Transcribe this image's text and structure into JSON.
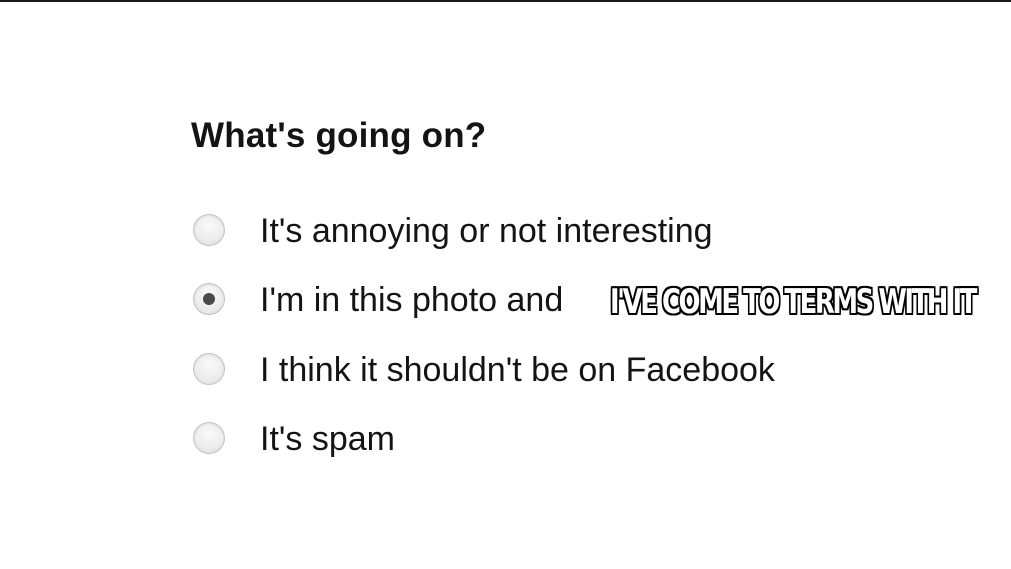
{
  "dialog": {
    "title": "What's going on?",
    "options": [
      {
        "label": "It's annoying or not interesting",
        "selected": false
      },
      {
        "label": "I'm in this photo and",
        "selected": true
      },
      {
        "label": "I think it shouldn't be on Facebook",
        "selected": false
      },
      {
        "label": "It's spam",
        "selected": false
      }
    ]
  },
  "overlay": {
    "caption": "I'VE COME TO TERMS WITH IT"
  },
  "colors": {
    "text": "#141414",
    "radio_border": "#c4c4c4",
    "radio_dot": "#4a4a4a",
    "caption_text": "#ffffff",
    "caption_outline": "#000000"
  }
}
